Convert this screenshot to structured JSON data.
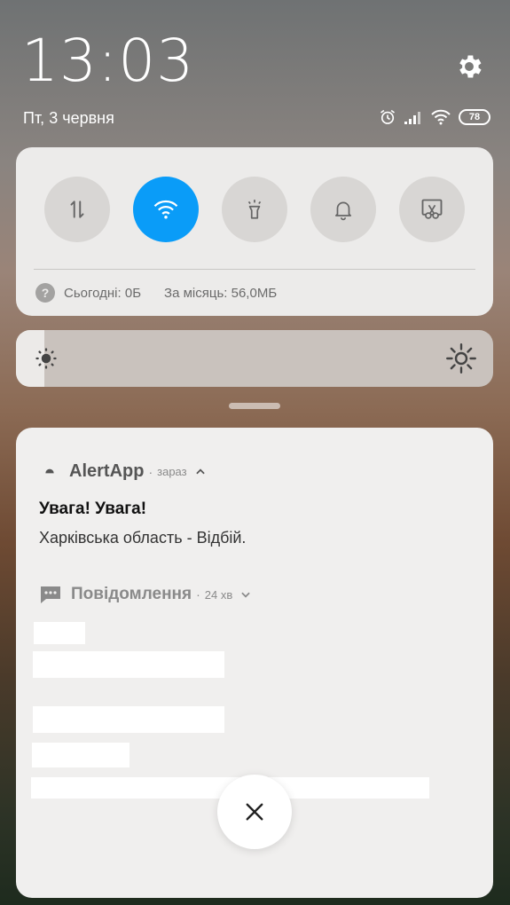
{
  "lockscreen": {
    "time": "13:03",
    "date": "Пт, 3 червня",
    "battery": "78"
  },
  "quick_settings": {
    "toggles": [
      {
        "name": "mobile-data",
        "icon": "data-transfer-icon",
        "on": false
      },
      {
        "name": "wifi",
        "icon": "wifi-icon",
        "on": true
      },
      {
        "name": "flashlight",
        "icon": "flashlight-icon",
        "on": false
      },
      {
        "name": "sound",
        "icon": "bell-icon",
        "on": false
      },
      {
        "name": "screenshot",
        "icon": "screenshot-scissors-icon",
        "on": false
      }
    ],
    "data_today": "Сьогодні: 0Б",
    "data_month": "За місяць: 56,0МБ",
    "help_glyph": "?"
  },
  "brightness": {
    "level": 0.06
  },
  "notifications": {
    "alert": {
      "app_name": "AlertApp",
      "separator": "·",
      "time": "зараз",
      "title": "Увага! Увага!",
      "body": "Харківська область - Відбій."
    },
    "messages": {
      "app_name": "Повідомлення",
      "separator": "·",
      "time": "24 хв"
    }
  },
  "colors": {
    "accent": "#0a9cf8",
    "panel": "#ecebea",
    "toggle_off": "#d8d6d4"
  }
}
